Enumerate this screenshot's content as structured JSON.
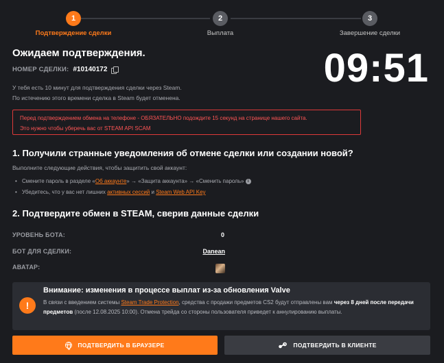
{
  "stepper": {
    "steps": [
      {
        "num": "1",
        "label": "Подтверждение сделки",
        "active": true
      },
      {
        "num": "2",
        "label": "Выплата",
        "active": false
      },
      {
        "num": "3",
        "label": "Завершение сделки",
        "active": false
      }
    ]
  },
  "header": {
    "title": "Ожидаем подтверждения.",
    "deal_label": "НОМЕР СДЕЛКИ:",
    "deal_number": "#10140172",
    "timer": "09:51"
  },
  "info": {
    "line1": "У тебя есть 10 минут для подтверждения сделки через Steam.",
    "line2": "По истечению этого времени сделка в Steam будет отменена."
  },
  "warning": {
    "line1": "Перед подтверждением обмена на телефоне - ОБЯЗАТЕЛЬНО подождите 15 секунд на странице нашего сайта.",
    "line2": "Это нужно чтобы уберечь вас от STEAM API SCAM"
  },
  "section1": {
    "title": "1. Получили странные уведомления об отмене сделки или создании новой?",
    "subtitle": "Выполните следующие действия, чтобы защитить свой аккаунт:",
    "b1_pre": "Смените пароль в разделе «",
    "b1_link": "Об аккаунте",
    "b1_post": "» → «Защита аккаунта» → «Сменить пароль»",
    "b1_info": "i",
    "b2_pre": "Убедитесь, что у вас нет лишних ",
    "b2_link1": "активных сессий",
    "b2_mid": " и ",
    "b2_link2": "Steam Web API Key"
  },
  "section2": {
    "title": "2. Подтвердите обмен в STEAM, сверив данные сделки",
    "rows": [
      {
        "label": "УРОВЕНЬ БОТА:",
        "value": "0"
      },
      {
        "label": "БОТ ДЛЯ СДЕЛКИ:",
        "value": "Danean"
      },
      {
        "label": "АВАТАР:",
        "value": ""
      }
    ]
  },
  "notice": {
    "icon": "!",
    "title": "Внимание: изменения в процессе выплат из-за обновления Valve",
    "t1": "В связи с введением системы ",
    "t_link": "Steam Trade Protection",
    "t2": ", средства с продажи предметов CS2 будут отправлены вам ",
    "t_bold": "через 8 дней после передачи предметов",
    "t3": " (после 12.08.2025 10:00). Отмена трейда со стороны пользователя приведет к аннулированию выплаты."
  },
  "buttons": {
    "browser": "ПОДТВЕРДИТЬ В БРАУЗЕРЕ",
    "client": "ПОДТВЕРДИТЬ В КЛИЕНТЕ"
  },
  "colors": {
    "accent": "#ff7a1a",
    "background": "#1b1c20",
    "warning": "#e03a3a",
    "panel": "#2b2d33"
  }
}
